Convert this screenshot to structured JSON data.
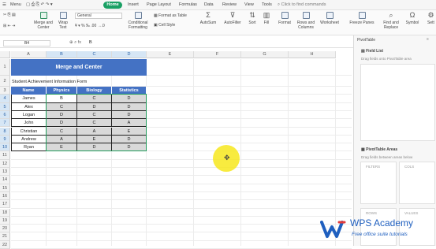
{
  "menubar": {
    "menu_label": "Menu",
    "tabs": [
      "Home",
      "Insert",
      "Page Layout",
      "Formulas",
      "Data",
      "Review",
      "View",
      "Tools"
    ],
    "search_placeholder": "Click to find commands"
  },
  "ribbon": {
    "merge_center": "Merge and\nCenter",
    "wrap_text": "Wrap\nText",
    "number_format": "General",
    "conditional_formatting": "Conditional\nFormatting",
    "format_as_table": "Format as Table",
    "cell_style": "Cell Style",
    "autosum": "AutoSum",
    "autofilter": "AutoFilter",
    "sort": "Sort",
    "fill": "Fill",
    "format": "Format",
    "rows_columns": "Rows and\nColumns",
    "worksheet": "Worksheet",
    "freeze_panes": "Freeze Panes",
    "find_replace": "Find and\nReplace",
    "symbol": "Symbol",
    "settings": "Sett"
  },
  "formula_bar": {
    "name_box": "B4",
    "fx_label": "fx",
    "value": "B"
  },
  "grid": {
    "columns": [
      "A",
      "B",
      "C",
      "D",
      "E",
      "F",
      "G",
      "H"
    ],
    "rows": [
      "1",
      "2",
      "3",
      "4",
      "5",
      "6",
      "7",
      "8",
      "9",
      "10",
      "11",
      "12",
      "13",
      "14",
      "15",
      "16",
      "17",
      "18",
      "19",
      "20",
      "21",
      "22"
    ],
    "title": "Merge and Center",
    "subtitle": "Student Achievement Information Form",
    "headers": [
      "Name",
      "Physics",
      "Biology",
      "Statistics"
    ],
    "data": [
      [
        "James",
        "B",
        "C",
        "D"
      ],
      [
        "Alex",
        "C",
        "D",
        "D"
      ],
      [
        "Logan",
        "D",
        "C",
        "D"
      ],
      [
        "John",
        "D",
        "C",
        "A"
      ],
      [
        "Christian",
        "C",
        "A",
        "E"
      ],
      [
        "Andrew",
        "A",
        "E",
        "D"
      ],
      [
        "Ryan",
        "E",
        "D",
        "D"
      ]
    ]
  },
  "pane": {
    "title": "PivotTable",
    "field_list": "Field List",
    "field_hint": "Drag fields onto PivotTable area",
    "areas_title": "PivotTable Areas",
    "areas_hint": "Drag fields between areas below",
    "filters": "FILTERS",
    "cols": "COLS",
    "rows": "ROWS",
    "values": "VALUES"
  },
  "watermark": {
    "brand": "WPS Academy",
    "tagline": "Free office suite tutorials"
  },
  "colors": {
    "accent_green": "#1aa064",
    "title_blue": "#4472c4",
    "selection_green": "#1f9b5a"
  }
}
